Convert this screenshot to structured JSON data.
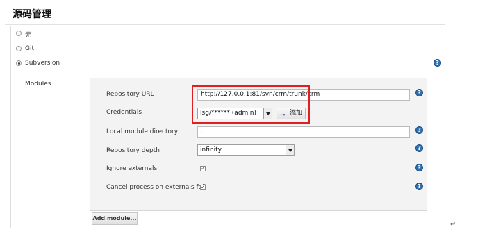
{
  "page": {
    "title": "源码管理",
    "return_mark": "↵"
  },
  "scm_options": [
    {
      "label": "无",
      "checked": false
    },
    {
      "label": "Git",
      "checked": false
    },
    {
      "label": "Subversion",
      "checked": true
    }
  ],
  "help_icon_glyph": "?",
  "modules": {
    "label": "Modules",
    "fields": {
      "repository_url": {
        "label": "Repository URL",
        "value": "http://127.0.0.1:81/svn/crm/trunk/crm"
      },
      "credentials": {
        "label": "Credentials",
        "selected": "lsg/****** (admin)",
        "add_button": "添加",
        "add_icon": "⊸"
      },
      "local_module_directory": {
        "label": "Local module directory",
        "value": "."
      },
      "repository_depth": {
        "label": "Repository depth",
        "selected": "infinity"
      },
      "ignore_externals": {
        "label": "Ignore externals",
        "checked": true,
        "mark": "✓"
      },
      "cancel_process": {
        "label": "Cancel process on externals fail",
        "checked": true,
        "mark": "✓"
      }
    },
    "add_module_button": "Add module..."
  },
  "colors": {
    "highlight_box": "#e02020",
    "help_icon": "#2f6fb0",
    "panel_bg": "#f3f3f3"
  }
}
